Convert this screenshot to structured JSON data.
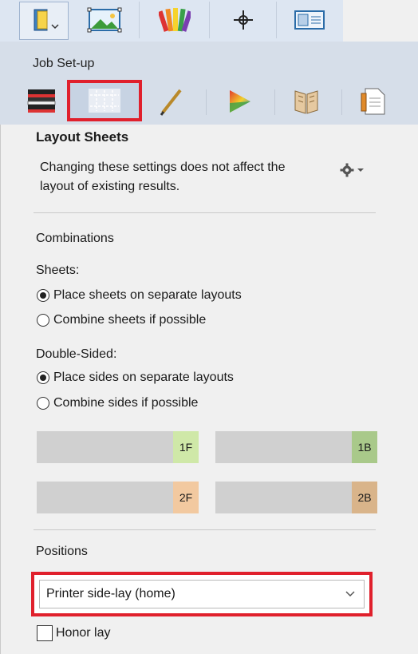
{
  "toolbar": {
    "buttons": [
      {
        "name": "job-properties",
        "icon": "book-icon"
      },
      {
        "name": "images",
        "icon": "image-icon"
      },
      {
        "name": "colors",
        "icon": "color-swatch-icon"
      },
      {
        "name": "target",
        "icon": "crosshair-icon"
      },
      {
        "name": "display",
        "icon": "window-icon"
      }
    ]
  },
  "job_setup": {
    "title": "Job Set-up",
    "tabs": [
      {
        "name": "printer",
        "icon": "printer-icon"
      },
      {
        "name": "layout-sheets",
        "icon": "sheet-grid-icon",
        "selected": true
      },
      {
        "name": "marks",
        "icon": "pen-icon"
      },
      {
        "name": "color",
        "icon": "color-triangle-icon"
      },
      {
        "name": "binding",
        "icon": "book-open-icon"
      },
      {
        "name": "documents",
        "icon": "document-icon"
      }
    ]
  },
  "section": {
    "title": "Layout Sheets",
    "description": "Changing these settings does not affect the layout of existing results."
  },
  "combinations": {
    "label": "Combinations",
    "sheets": {
      "label": "Sheets:",
      "options": [
        "Place sheets on separate layouts",
        "Combine sheets if possible"
      ],
      "selected": 0
    },
    "double_sided": {
      "label": "Double-Sided:",
      "options": [
        "Place sides on separate layouts",
        "Combine sides if possible"
      ],
      "selected": 0
    }
  },
  "preview": {
    "tags": [
      "1F",
      "1B",
      "2F",
      "2B"
    ],
    "colors": {
      "1F": "#cfe8a8",
      "1B": "#a9c98a",
      "2F": "#f2c9a0",
      "2B": "#d9b48a"
    }
  },
  "positions": {
    "label": "Positions",
    "selected": "Printer side-lay (home)",
    "honor_lay_label": "Honor lay",
    "honor_lay_checked": false
  },
  "colors": {
    "highlight": "#e0202c",
    "toolbar_bg": "#dde6f2",
    "header_bg": "#d6dee9",
    "panel_bg": "#f0f0f0"
  }
}
